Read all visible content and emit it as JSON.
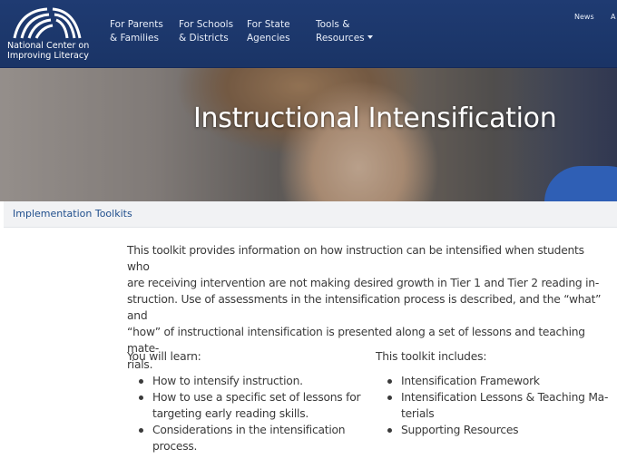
{
  "header": {
    "logo_lines": [
      "National Center on",
      "Improving Literacy"
    ],
    "nav": [
      {
        "line1": "For Parents",
        "line2": "& Families"
      },
      {
        "line1": "For Schools",
        "line2": "& Districts"
      },
      {
        "line1": "For State",
        "line2": "Agencies"
      },
      {
        "line1": "Tools &",
        "line2": "Resources"
      }
    ],
    "util_links": [
      "News",
      "A"
    ]
  },
  "hero": {
    "title": "Instructional Intensification"
  },
  "breadcrumb": {
    "link": "Implementation Toolkits"
  },
  "content": {
    "intro_lines": [
      "This toolkit provides information on how instruction can be intensified when students who",
      "are receiving intervention are not making desired growth in Tier 1 and Tier 2 reading in-",
      "struction. Use of assessments in the intensification process is described, and the “what” and",
      "“how” of instructional intensification is presented along a set of lessons and teaching mate-",
      "rials."
    ],
    "learn": {
      "heading": "You will learn:",
      "items": [
        {
          "l1": "How to intensify instruction.",
          "l2": ""
        },
        {
          "l1": "How to use a specific set of lessons for",
          "l2": "targeting early reading skills."
        },
        {
          "l1": "Considerations in the intensification",
          "l2": "process."
        }
      ]
    },
    "includes": {
      "heading": "This toolkit includes:",
      "items": [
        {
          "l1": "Intensification Framework",
          "l2": ""
        },
        {
          "l1": "Intensification Lessons & Teaching Ma-",
          "l2": "terials"
        },
        {
          "l1": "Supporting Resources",
          "l2": ""
        }
      ]
    }
  }
}
